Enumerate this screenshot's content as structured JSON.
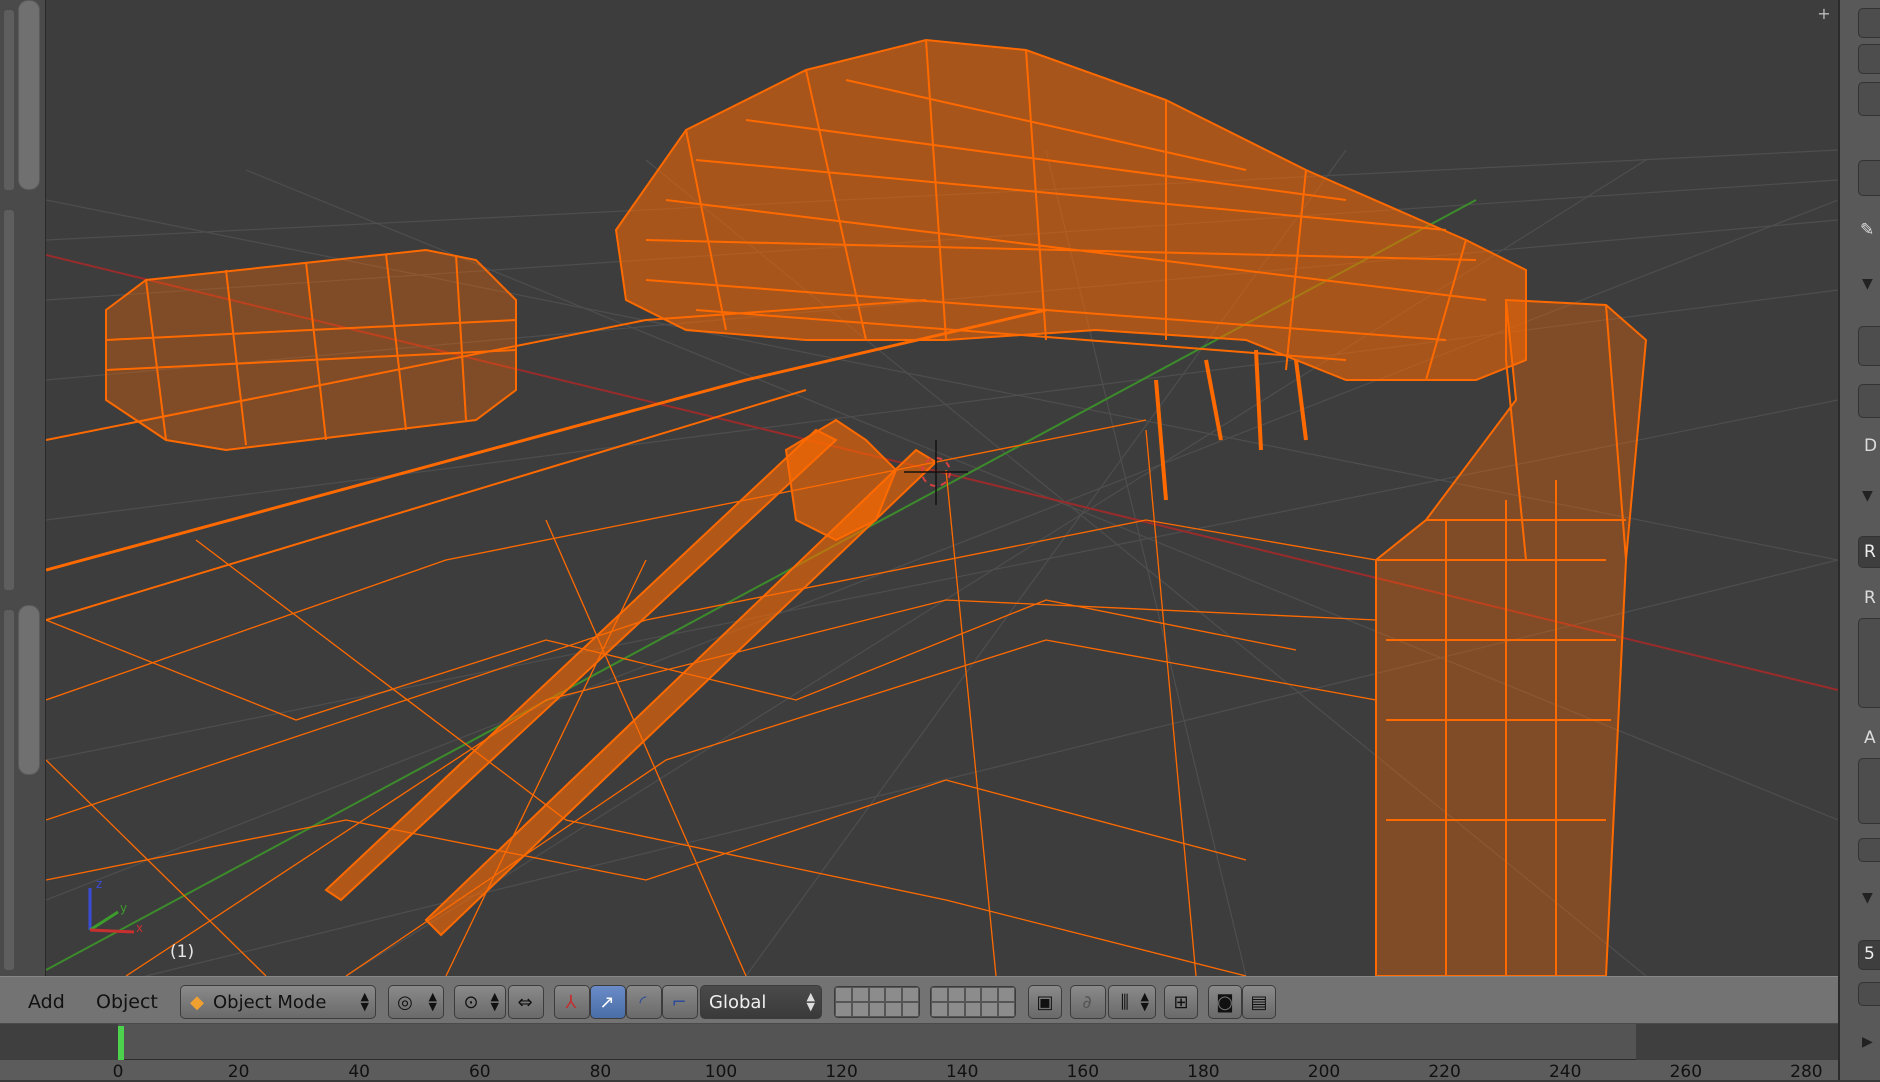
{
  "viewport": {
    "frame_label": "(1)",
    "corner_icon": "plus-icon",
    "wireframe_color": "#ff6a00",
    "grid_color": "#4e4e4e",
    "x_axis_color": "#9a2b2b",
    "y_axis_color": "#3c8c2c"
  },
  "header": {
    "menu_add": "Add",
    "menu_object": "Object",
    "mode_selector": "Object Mode",
    "orientation": "Global"
  },
  "timeline": {
    "current_frame": 1,
    "ruler_ticks": [
      "0",
      "20",
      "40",
      "60",
      "80",
      "100",
      "120",
      "140",
      "160",
      "180",
      "200",
      "220",
      "240",
      "260",
      "280"
    ],
    "highlight_color": "#4cd24c"
  },
  "right_panel": {
    "letters": [
      "D",
      "R",
      "R",
      "A",
      "5"
    ]
  }
}
